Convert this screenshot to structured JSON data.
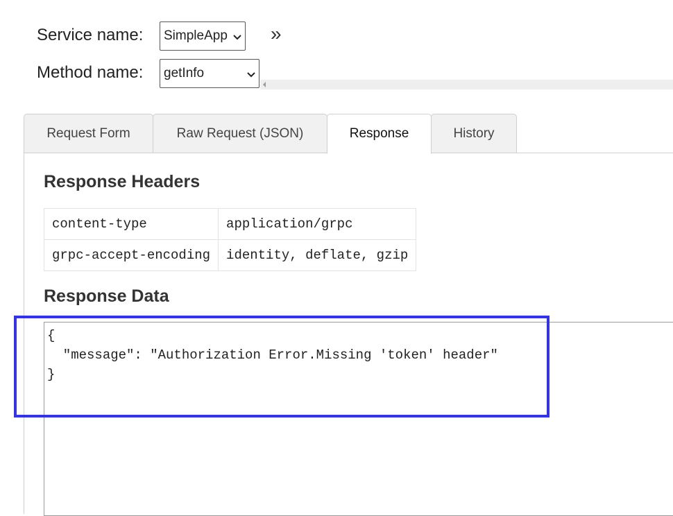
{
  "service": {
    "label": "Service name:",
    "value": "SimpleApp"
  },
  "method": {
    "label": "Method name:",
    "value": "getInfo"
  },
  "expand_glyph": "»",
  "tabs": [
    {
      "label": "Request Form"
    },
    {
      "label": "Raw Request (JSON)"
    },
    {
      "label": "Response"
    },
    {
      "label": "History"
    }
  ],
  "active_tab": "Response",
  "response_headers": {
    "title": "Response Headers",
    "rows": [
      {
        "key": "content-type",
        "value": "application/grpc"
      },
      {
        "key": "grpc-accept-encoding",
        "value": "identity, deflate, gzip"
      }
    ]
  },
  "response_data": {
    "title": "Response Data",
    "body": "{\n  \"message\": \"Authorization Error.Missing 'token' header\"\n}"
  },
  "colors": {
    "highlight": "#3535e0",
    "tab_inactive": "#f1f1f1",
    "border": "#cfcfcf"
  }
}
